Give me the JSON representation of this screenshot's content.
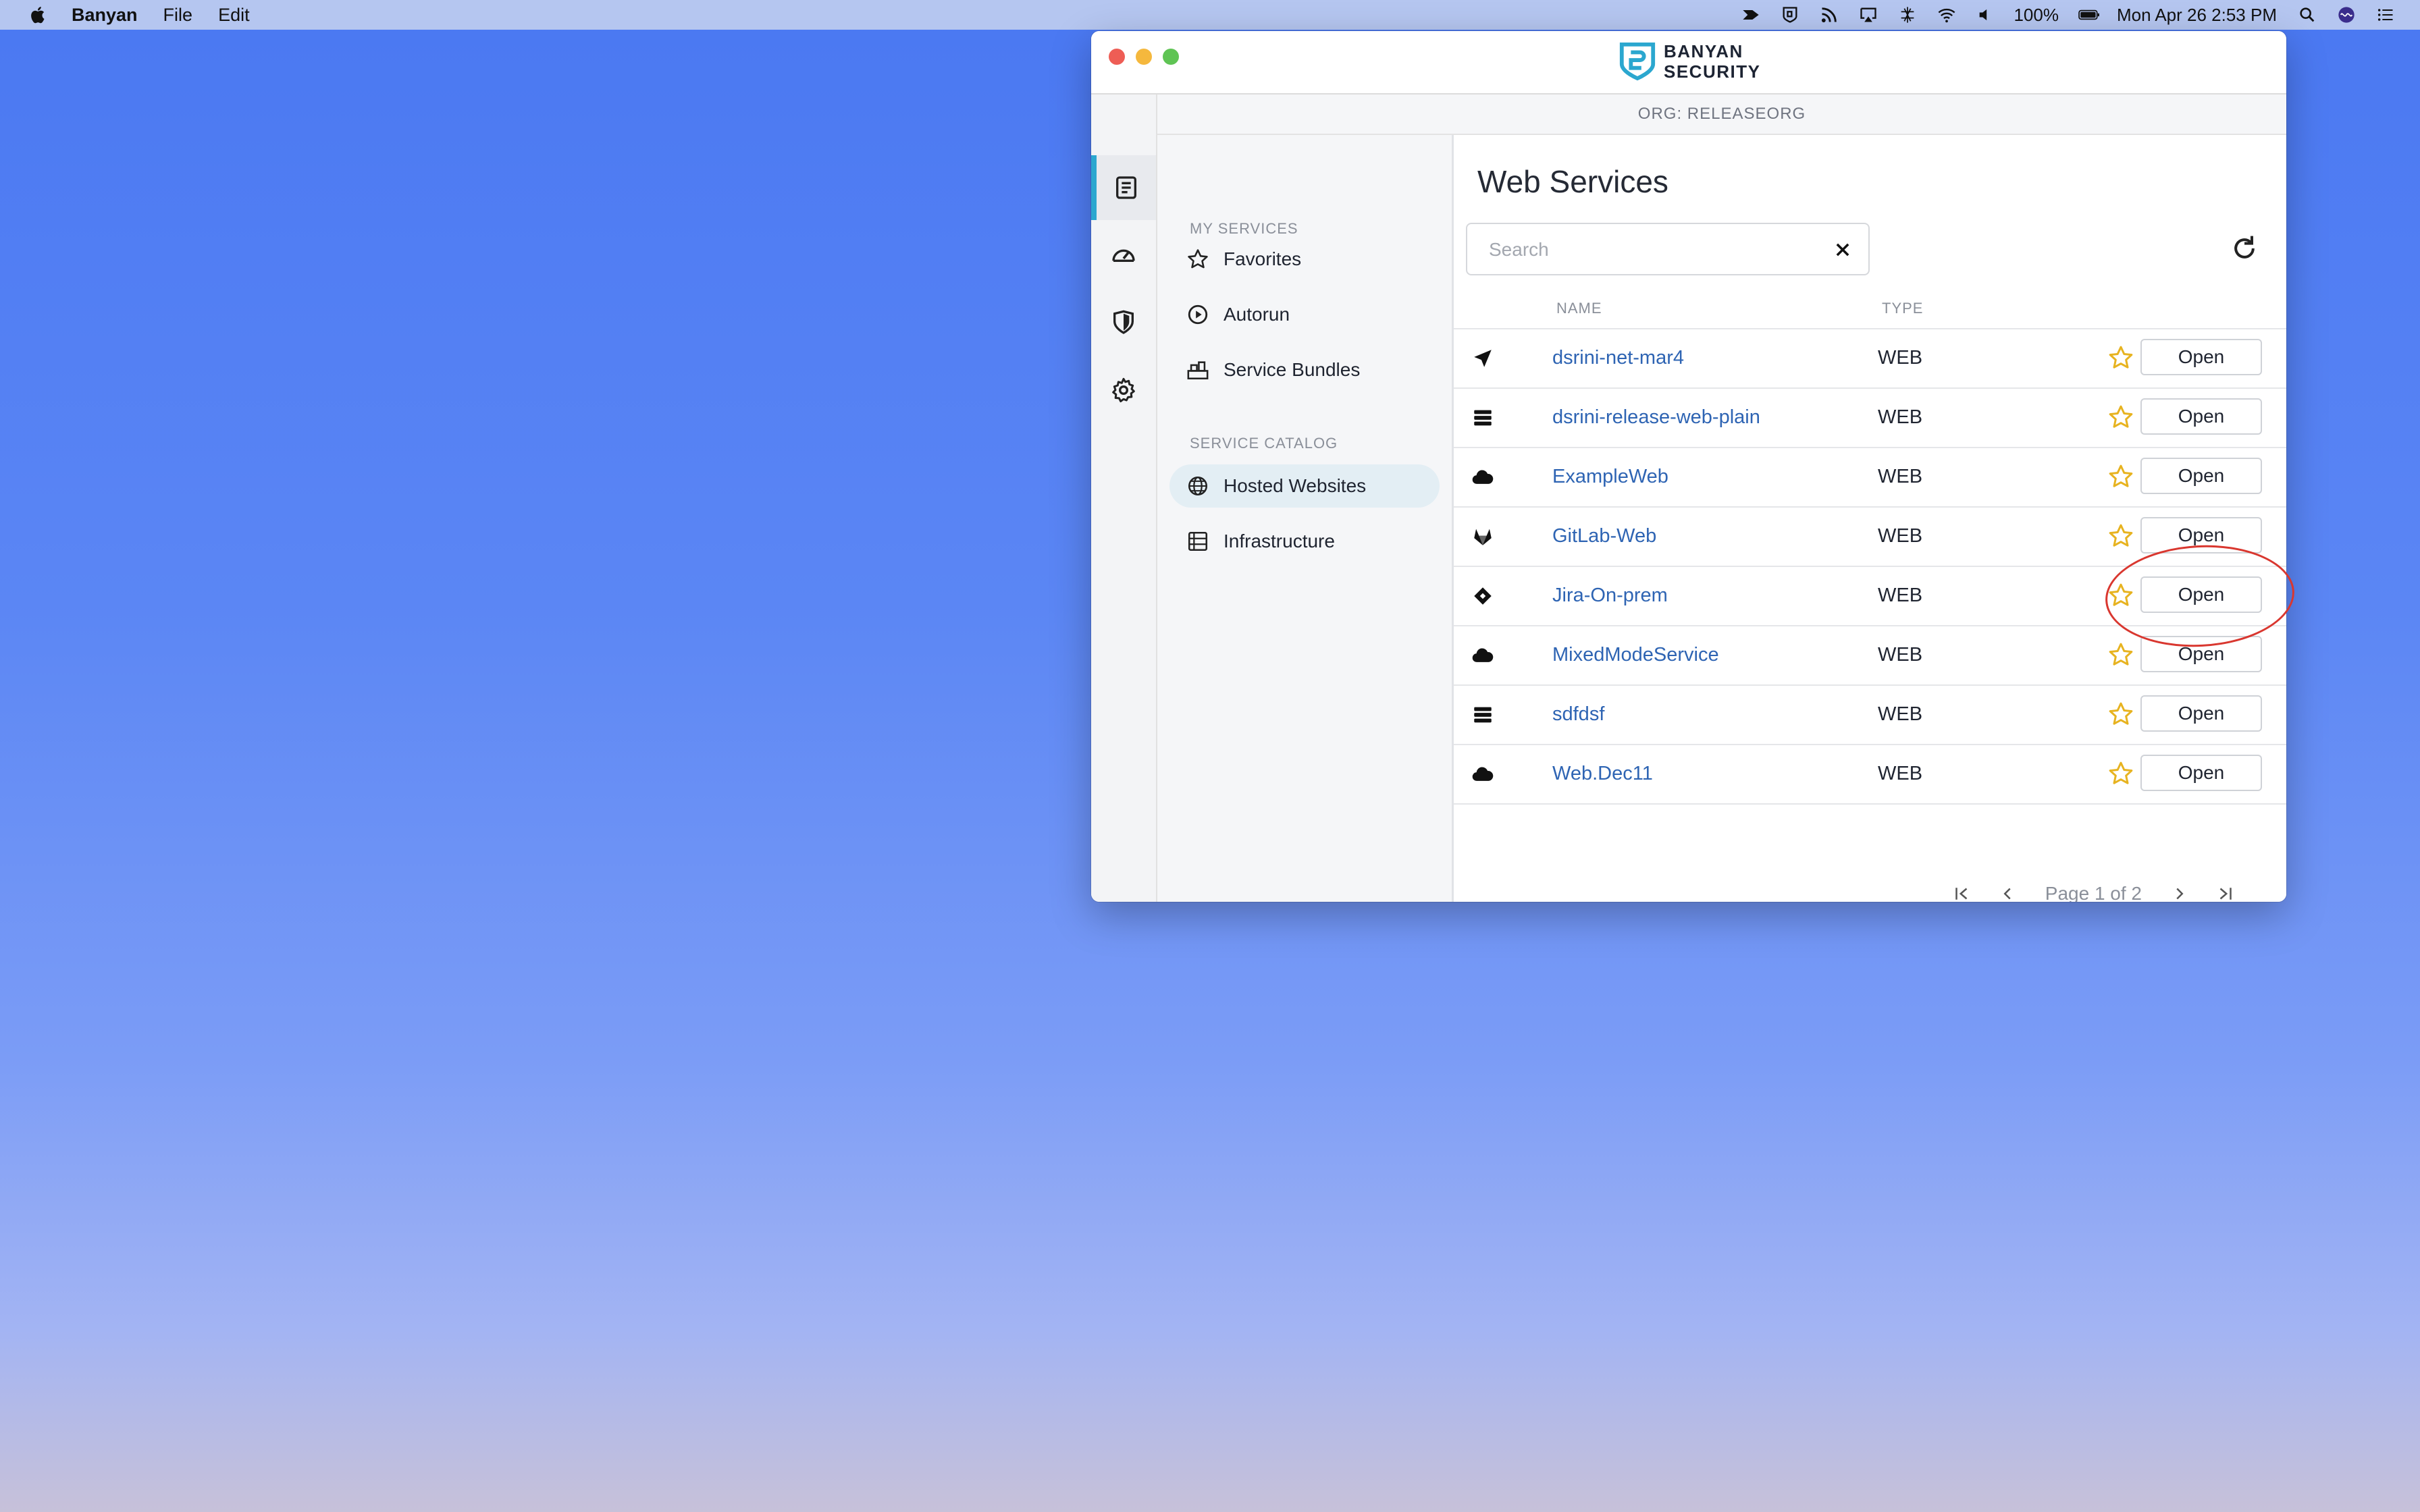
{
  "menubar": {
    "app_name": "Banyan",
    "menus": [
      "File",
      "Edit"
    ],
    "battery": "100%",
    "datetime": "Mon Apr 26  2:53 PM"
  },
  "window": {
    "brand_line1": "BANYAN",
    "brand_line2": "SECURITY",
    "org": "ORG: RELEASEORG"
  },
  "sidebar": {
    "my_services_label": "MY SERVICES",
    "my_services": [
      {
        "label": "Favorites",
        "icon": "star-outline-icon"
      },
      {
        "label": "Autorun",
        "icon": "play-circle-icon"
      },
      {
        "label": "Service Bundles",
        "icon": "bundle-icon"
      }
    ],
    "catalog_label": "SERVICE CATALOG",
    "catalog": [
      {
        "label": "Hosted Websites",
        "icon": "globe-icon",
        "active": true
      },
      {
        "label": "Infrastructure",
        "icon": "server-icon",
        "active": false
      }
    ]
  },
  "main": {
    "title": "Web Services",
    "search_placeholder": "Search",
    "columns": {
      "name": "NAME",
      "type": "TYPE"
    },
    "rows": [
      {
        "icon": "location-arrow-icon",
        "name": "dsrini-net-mar4",
        "type": "WEB",
        "action": "Open"
      },
      {
        "icon": "server-stack-icon",
        "name": "dsrini-release-web-plain",
        "type": "WEB",
        "action": "Open"
      },
      {
        "icon": "cloud-icon",
        "name": "ExampleWeb",
        "type": "WEB",
        "action": "Open"
      },
      {
        "icon": "gitlab-icon",
        "name": "GitLab-Web",
        "type": "WEB",
        "action": "Open"
      },
      {
        "icon": "jira-diamond-icon",
        "name": "Jira-On-prem",
        "type": "WEB",
        "action": "Open"
      },
      {
        "icon": "cloud-icon",
        "name": "MixedModeService",
        "type": "WEB",
        "action": "Open"
      },
      {
        "icon": "server-stack-icon",
        "name": "sdfdsf",
        "type": "WEB",
        "action": "Open"
      },
      {
        "icon": "cloud-icon",
        "name": "Web.Dec11",
        "type": "WEB",
        "action": "Open"
      }
    ],
    "pagination": "Page 1 of 2"
  },
  "colors": {
    "accent": "#2ba7cf",
    "link": "#2e64b3",
    "star": "#e7b320",
    "annotation": "#d9372f"
  }
}
